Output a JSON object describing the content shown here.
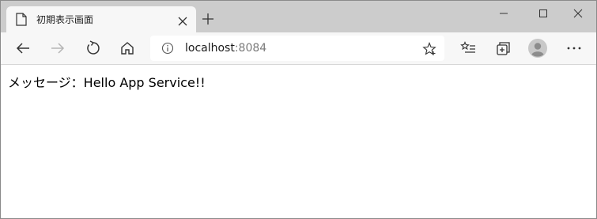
{
  "tab": {
    "title": "初期表示画面",
    "page_icon": "page-icon",
    "close_icon": "close-icon"
  },
  "new_tab_icon": "plus-icon",
  "window_controls": [
    "minimize-icon",
    "maximize-icon",
    "close-icon"
  ],
  "toolbar": {
    "icons": [
      "back-arrow-icon",
      "forward-arrow-icon",
      "refresh-icon",
      "home-icon",
      "favorites-list-icon",
      "collections-icon",
      "profile-avatar-icon",
      "more-dots-icon"
    ],
    "forward_disabled": true
  },
  "address": {
    "host": "localhost",
    "port": ":8084",
    "info_icon": "info-icon",
    "favorite_icon": "star-add-icon"
  },
  "page": {
    "message": "メッセージ：Hello App Service!!"
  },
  "colors": {
    "titlebar": "#cccccc",
    "toolbar": "#f7f7f7",
    "icon": "#333333",
    "disabled_icon": "#b5b5b5"
  }
}
